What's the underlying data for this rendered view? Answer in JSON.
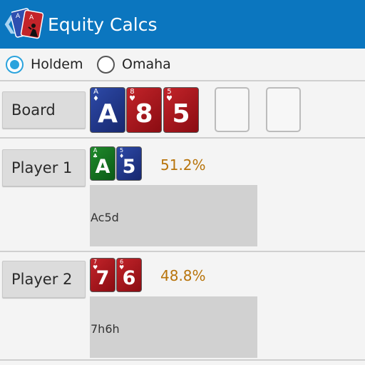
{
  "app": {
    "title": "Equity Calcs"
  },
  "game_type": {
    "options": [
      {
        "label": "Holdem",
        "selected": true
      },
      {
        "label": "Omaha",
        "selected": false
      }
    ]
  },
  "board": {
    "button_label": "Board",
    "cards": [
      {
        "rank": "A",
        "suit": "♦",
        "color": "blue"
      },
      {
        "rank": "8",
        "suit": "♥",
        "color": "red"
      },
      {
        "rank": "5",
        "suit": "♥",
        "color": "red"
      }
    ]
  },
  "players": [
    {
      "button_label": "Player 1",
      "cards": [
        {
          "rank": "A",
          "suit": "♣",
          "color": "green"
        },
        {
          "rank": "5",
          "suit": "♦",
          "color": "blue"
        }
      ],
      "equity": "51.2%",
      "hand_text": "Ac5d"
    },
    {
      "button_label": "Player 2",
      "cards": [
        {
          "rank": "7",
          "suit": "♥",
          "color": "red"
        },
        {
          "rank": "6",
          "suit": "♥",
          "color": "red"
        }
      ],
      "equity": "48.8%",
      "hand_text": "7h6h"
    }
  ],
  "colors": {
    "appbar": "#0b76bf",
    "radio_accent": "#2ba3dd",
    "equity_text": "#b8740b"
  }
}
